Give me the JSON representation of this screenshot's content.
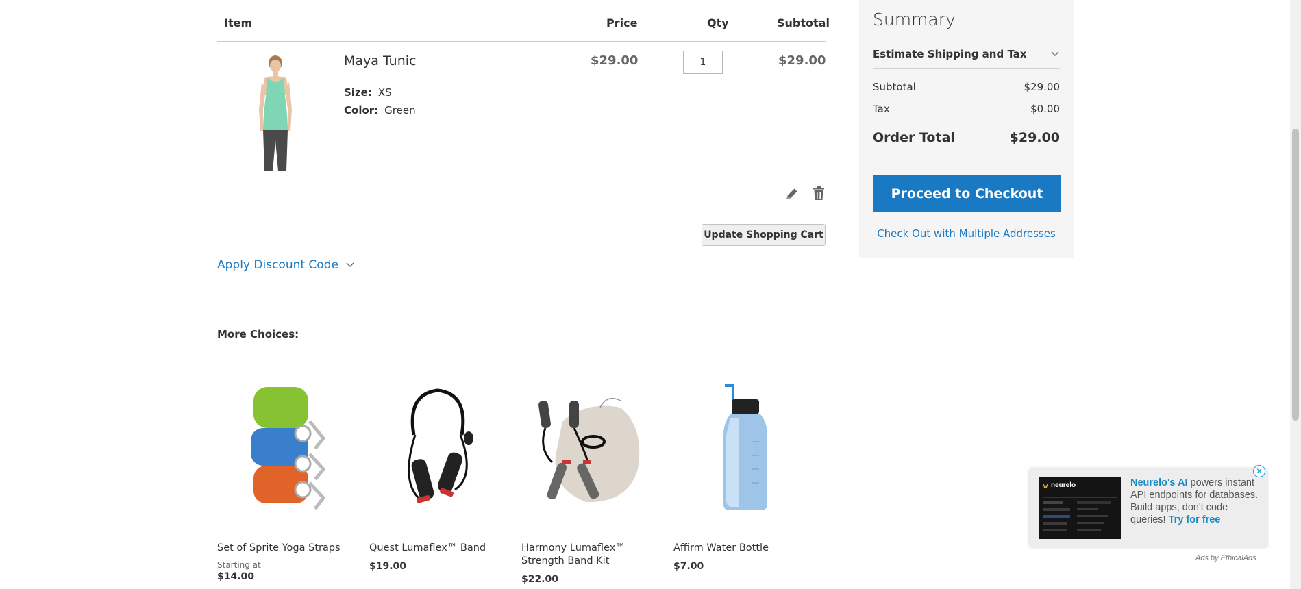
{
  "cart": {
    "headers": {
      "item": "Item",
      "price": "Price",
      "qty": "Qty",
      "subtotal": "Subtotal"
    },
    "items": [
      {
        "name": "Maya Tunic",
        "options": [
          {
            "label": "Size:",
            "value": "XS"
          },
          {
            "label": "Color:",
            "value": "Green"
          }
        ],
        "price": "$29.00",
        "qty": "1",
        "subtotal": "$29.00",
        "icons": {
          "edit": "pencil-icon",
          "remove": "trash-icon"
        }
      }
    ],
    "update_button": "Update Shopping Cart",
    "discount_label": "Apply Discount Code"
  },
  "more_choices": {
    "title": "More Choices:",
    "products": [
      {
        "name": "Set of Sprite Yoga Straps",
        "starting": "Starting at",
        "price": "$14.00"
      },
      {
        "name": "Quest Lumaflex™ Band",
        "price": "$19.00"
      },
      {
        "name": "Harmony Lumaflex™ Strength Band Kit",
        "price": "$22.00"
      },
      {
        "name": "Affirm Water Bottle",
        "price": "$7.00"
      }
    ]
  },
  "summary": {
    "title": "Summary",
    "estimate_label": "Estimate Shipping and Tax",
    "subtotal_label": "Subtotal",
    "subtotal_value": "$29.00",
    "tax_label": "Tax",
    "tax_value": "$0.00",
    "total_label": "Order Total",
    "total_value": "$29.00",
    "checkout_button": "Proceed to Checkout",
    "multi_address_link": "Check Out with Multiple Addresses"
  },
  "ad": {
    "close": "✕",
    "logo_text": "neurelo",
    "brand": "Neurelo's AI",
    "body": " powers instant API endpoints for databases. Build apps, don't code queries! ",
    "cta": "Try for free",
    "footer": "Ads by EthicalAds"
  },
  "colors": {
    "accent": "#1979c3",
    "summary_bg": "#f5f5f5"
  }
}
